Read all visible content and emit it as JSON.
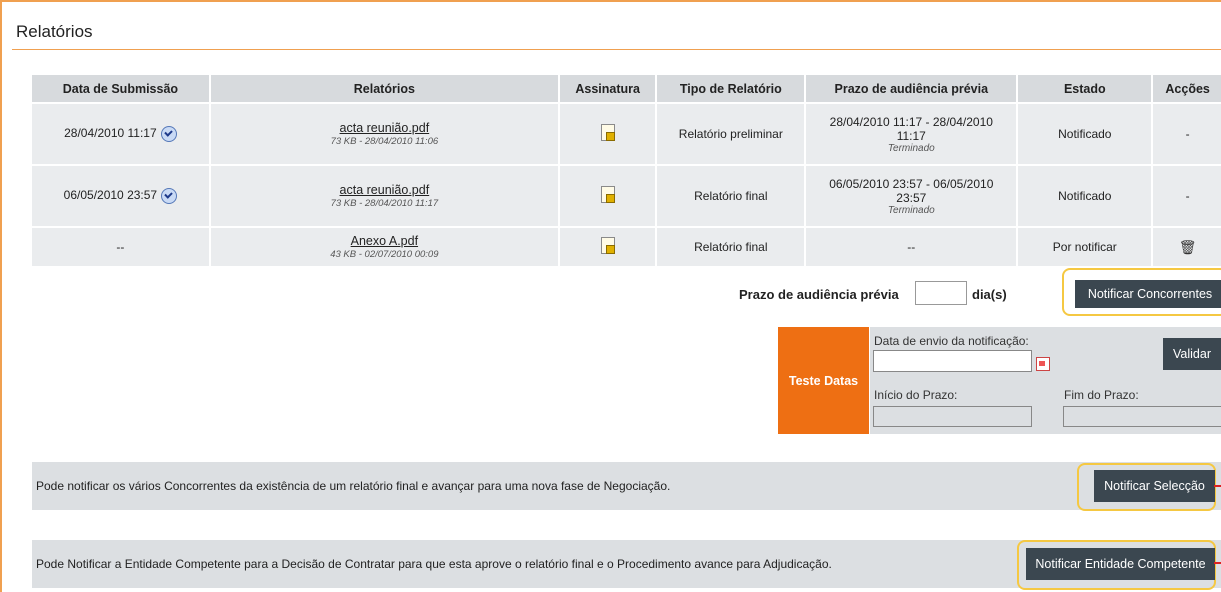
{
  "page": {
    "title": "Relatórios"
  },
  "table": {
    "headers": [
      "Data de Submissão",
      "Relatórios",
      "Assinatura",
      "Tipo de Relatório",
      "Prazo de audiência prévia",
      "Estado",
      "Acções"
    ],
    "rows": [
      {
        "date": "28/04/2010 11:17",
        "file": "acta reunião.pdf",
        "meta": "73 KB - 28/04/2010 11:06",
        "tipo": "Relatório preliminar",
        "prazo": "28/04/2010 11:17 - 28/04/2010 11:17",
        "prazo_status": "Terminado",
        "estado": "Notificado",
        "accoes": "-"
      },
      {
        "date": "06/05/2010 23:57",
        "file": "acta reunião.pdf",
        "meta": "73 KB - 28/04/2010 11:17",
        "tipo": "Relatório final",
        "prazo": "06/05/2010 23:57 - 06/05/2010 23:57",
        "prazo_status": "Terminado",
        "estado": "Notificado",
        "accoes": "-"
      },
      {
        "date": "--",
        "file": "Anexo A.pdf",
        "meta": "43 KB - 02/07/2010 00:09",
        "tipo": "Relatório final",
        "prazo": "--",
        "prazo_status": "",
        "estado": "Por notificar",
        "accoes": ""
      }
    ]
  },
  "prazo": {
    "label": "Prazo de audiência prévia",
    "unit": "dia(s)",
    "value": ""
  },
  "buttons": {
    "notificar_concorrentes": "Notificar Concorrentes",
    "validar": "Validar",
    "notificar_seleccao": "Notificar Selecção",
    "notificar_entidade": "Notificar Entidade Competente"
  },
  "teste_datas": {
    "title": "Teste Datas",
    "envio_label": "Data de envio da notificação:",
    "inicio_label": "Início do Prazo:",
    "fim_label": "Fim do Prazo:",
    "envio_value": "",
    "inicio_value": "",
    "fim_value": ""
  },
  "bands": {
    "seleccao_text": "Pode notificar os vários Concorrentes da existência de um relatório final e avançar para uma nova fase de Negociação.",
    "entidade_text": "Pode Notificar a Entidade Competente para a Decisão de Contratar para que esta aprove o relatório final e o Procedimento avance para Adjudicação."
  },
  "colors": {
    "accent": "#ee6f13",
    "highlight": "#f5c842",
    "button": "#3b4750"
  }
}
